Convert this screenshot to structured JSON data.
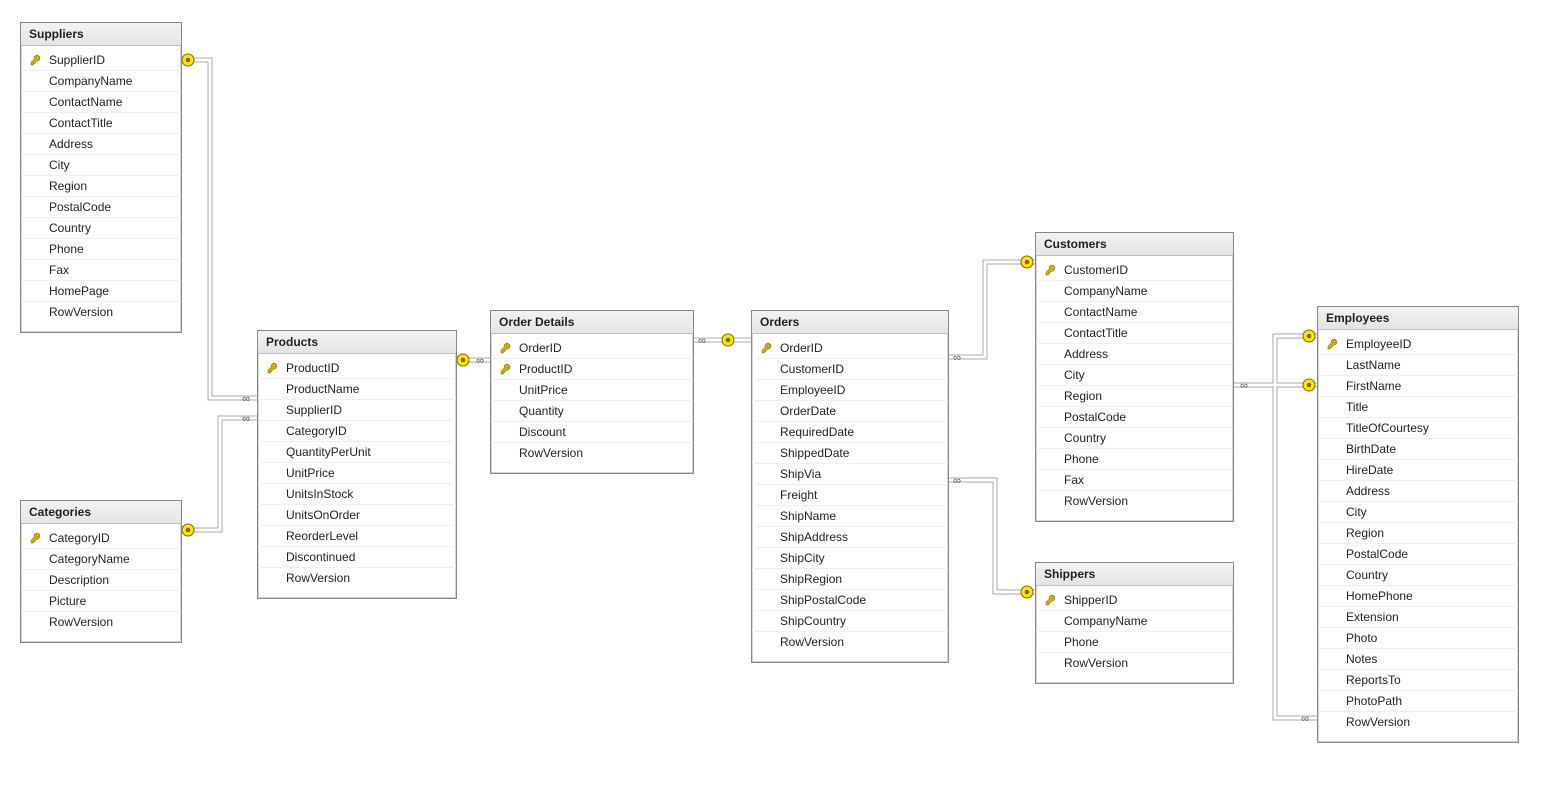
{
  "tables": {
    "suppliers": {
      "title": "Suppliers",
      "fields": [
        {
          "name": "SupplierID",
          "pk": true
        },
        {
          "name": "CompanyName",
          "pk": false
        },
        {
          "name": "ContactName",
          "pk": false
        },
        {
          "name": "ContactTitle",
          "pk": false
        },
        {
          "name": "Address",
          "pk": false
        },
        {
          "name": "City",
          "pk": false
        },
        {
          "name": "Region",
          "pk": false
        },
        {
          "name": "PostalCode",
          "pk": false
        },
        {
          "name": "Country",
          "pk": false
        },
        {
          "name": "Phone",
          "pk": false
        },
        {
          "name": "Fax",
          "pk": false
        },
        {
          "name": "HomePage",
          "pk": false
        },
        {
          "name": "RowVersion",
          "pk": false
        }
      ]
    },
    "categories": {
      "title": "Categories",
      "fields": [
        {
          "name": "CategoryID",
          "pk": true
        },
        {
          "name": "CategoryName",
          "pk": false
        },
        {
          "name": "Description",
          "pk": false
        },
        {
          "name": "Picture",
          "pk": false
        },
        {
          "name": "RowVersion",
          "pk": false
        }
      ]
    },
    "products": {
      "title": "Products",
      "fields": [
        {
          "name": "ProductID",
          "pk": true
        },
        {
          "name": "ProductName",
          "pk": false
        },
        {
          "name": "SupplierID",
          "pk": false
        },
        {
          "name": "CategoryID",
          "pk": false
        },
        {
          "name": "QuantityPerUnit",
          "pk": false
        },
        {
          "name": "UnitPrice",
          "pk": false
        },
        {
          "name": "UnitsInStock",
          "pk": false
        },
        {
          "name": "UnitsOnOrder",
          "pk": false
        },
        {
          "name": "ReorderLevel",
          "pk": false
        },
        {
          "name": "Discontinued",
          "pk": false
        },
        {
          "name": "RowVersion",
          "pk": false
        }
      ]
    },
    "orderdetails": {
      "title": "Order Details",
      "fields": [
        {
          "name": "OrderID",
          "pk": true
        },
        {
          "name": "ProductID",
          "pk": true
        },
        {
          "name": "UnitPrice",
          "pk": false
        },
        {
          "name": "Quantity",
          "pk": false
        },
        {
          "name": "Discount",
          "pk": false
        },
        {
          "name": "RowVersion",
          "pk": false
        }
      ]
    },
    "orders": {
      "title": "Orders",
      "fields": [
        {
          "name": "OrderID",
          "pk": true
        },
        {
          "name": "CustomerID",
          "pk": false
        },
        {
          "name": "EmployeeID",
          "pk": false
        },
        {
          "name": "OrderDate",
          "pk": false
        },
        {
          "name": "RequiredDate",
          "pk": false
        },
        {
          "name": "ShippedDate",
          "pk": false
        },
        {
          "name": "ShipVia",
          "pk": false
        },
        {
          "name": "Freight",
          "pk": false
        },
        {
          "name": "ShipName",
          "pk": false
        },
        {
          "name": "ShipAddress",
          "pk": false
        },
        {
          "name": "ShipCity",
          "pk": false
        },
        {
          "name": "ShipRegion",
          "pk": false
        },
        {
          "name": "ShipPostalCode",
          "pk": false
        },
        {
          "name": "ShipCountry",
          "pk": false
        },
        {
          "name": "RowVersion",
          "pk": false
        }
      ]
    },
    "customers": {
      "title": "Customers",
      "fields": [
        {
          "name": "CustomerID",
          "pk": true
        },
        {
          "name": "CompanyName",
          "pk": false
        },
        {
          "name": "ContactName",
          "pk": false
        },
        {
          "name": "ContactTitle",
          "pk": false
        },
        {
          "name": "Address",
          "pk": false
        },
        {
          "name": "City",
          "pk": false
        },
        {
          "name": "Region",
          "pk": false
        },
        {
          "name": "PostalCode",
          "pk": false
        },
        {
          "name": "Country",
          "pk": false
        },
        {
          "name": "Phone",
          "pk": false
        },
        {
          "name": "Fax",
          "pk": false
        },
        {
          "name": "RowVersion",
          "pk": false
        }
      ]
    },
    "shippers": {
      "title": "Shippers",
      "fields": [
        {
          "name": "ShipperID",
          "pk": true
        },
        {
          "name": "CompanyName",
          "pk": false
        },
        {
          "name": "Phone",
          "pk": false
        },
        {
          "name": "RowVersion",
          "pk": false
        }
      ]
    },
    "employees": {
      "title": "Employees",
      "fields": [
        {
          "name": "EmployeeID",
          "pk": true
        },
        {
          "name": "LastName",
          "pk": false
        },
        {
          "name": "FirstName",
          "pk": false
        },
        {
          "name": "Title",
          "pk": false
        },
        {
          "name": "TitleOfCourtesy",
          "pk": false
        },
        {
          "name": "BirthDate",
          "pk": false
        },
        {
          "name": "HireDate",
          "pk": false
        },
        {
          "name": "Address",
          "pk": false
        },
        {
          "name": "City",
          "pk": false
        },
        {
          "name": "Region",
          "pk": false
        },
        {
          "name": "PostalCode",
          "pk": false
        },
        {
          "name": "Country",
          "pk": false
        },
        {
          "name": "HomePhone",
          "pk": false
        },
        {
          "name": "Extension",
          "pk": false
        },
        {
          "name": "Photo",
          "pk": false
        },
        {
          "name": "Notes",
          "pk": false
        },
        {
          "name": "ReportsTo",
          "pk": false
        },
        {
          "name": "PhotoPath",
          "pk": false
        },
        {
          "name": "RowVersion",
          "pk": false
        }
      ]
    }
  },
  "relationships": [
    {
      "from": "suppliers.SupplierID",
      "to": "products.SupplierID"
    },
    {
      "from": "categories.CategoryID",
      "to": "products.CategoryID"
    },
    {
      "from": "products.ProductID",
      "to": "orderdetails.ProductID"
    },
    {
      "from": "orders.OrderID",
      "to": "orderdetails.OrderID"
    },
    {
      "from": "customers.CustomerID",
      "to": "orders.CustomerID"
    },
    {
      "from": "shippers.ShipperID",
      "to": "orders.ShipVia"
    },
    {
      "from": "employees.EmployeeID",
      "to": "orders.EmployeeID"
    },
    {
      "from": "employees.EmployeeID",
      "to": "employees.ReportsTo"
    }
  ]
}
